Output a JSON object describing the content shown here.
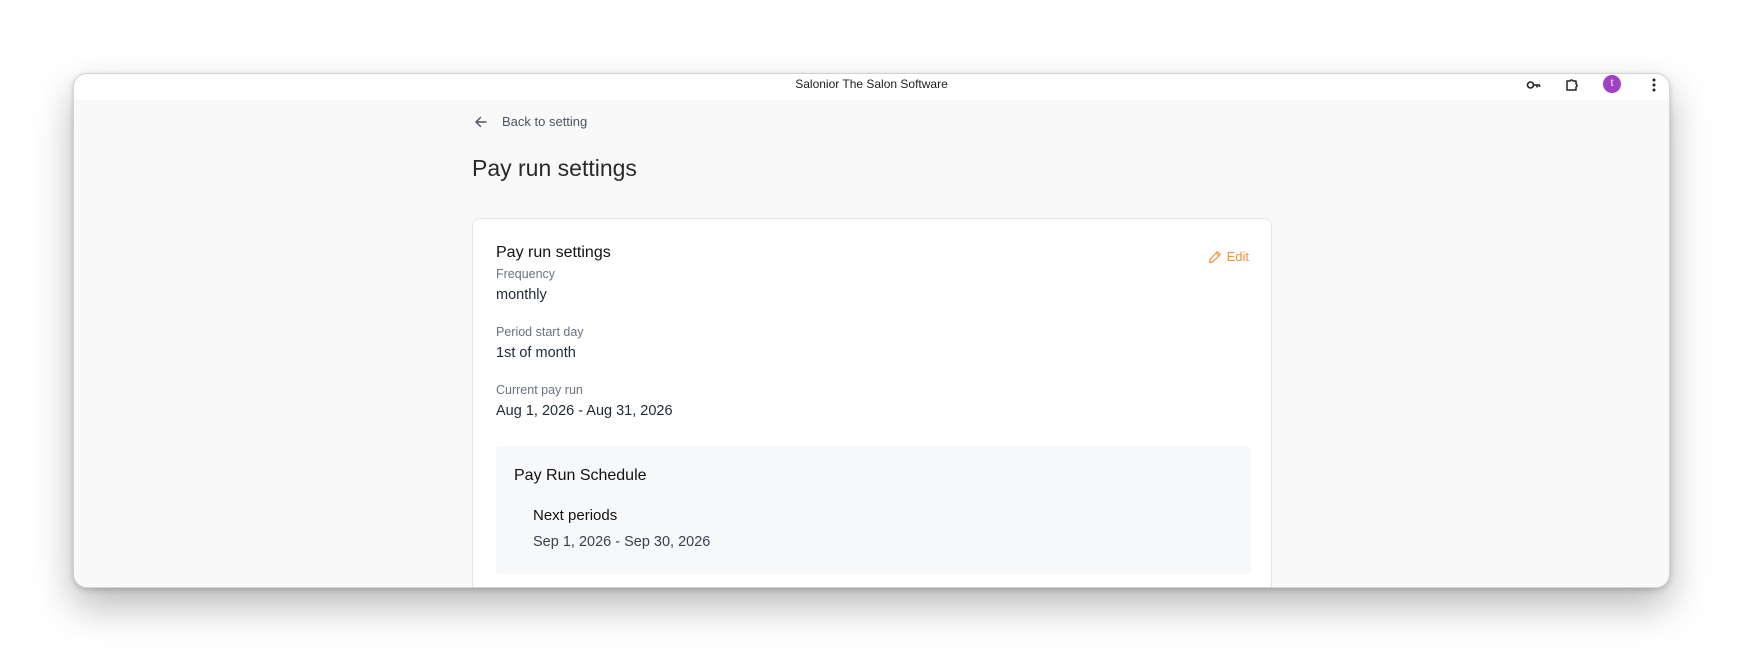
{
  "window": {
    "title": "Salonior The Salon Software",
    "avatar_letter": "t"
  },
  "icons": {
    "titlebar": [
      "key-icon",
      "extension-icon",
      "avatar",
      "more-vertical-icon"
    ],
    "back": "arrow-left-icon",
    "edit": "pencil-icon"
  },
  "colors": {
    "accent": "#f0933a",
    "avatar": "#a142c4"
  },
  "nav": {
    "back_label": "Back to setting"
  },
  "page": {
    "title": "Pay run settings"
  },
  "card": {
    "title": "Pay run settings",
    "edit_label": "Edit",
    "fields": [
      {
        "label": "Frequency",
        "value": "monthly"
      },
      {
        "label": "Period start day",
        "value": "1st of month"
      },
      {
        "label": "Current pay run",
        "value": "Aug 1, 2026 - Aug 31, 2026"
      }
    ]
  },
  "schedule": {
    "title": "Pay Run Schedule",
    "next_title": "Next periods",
    "next_value": "Sep 1, 2026 - Sep 30, 2026"
  }
}
